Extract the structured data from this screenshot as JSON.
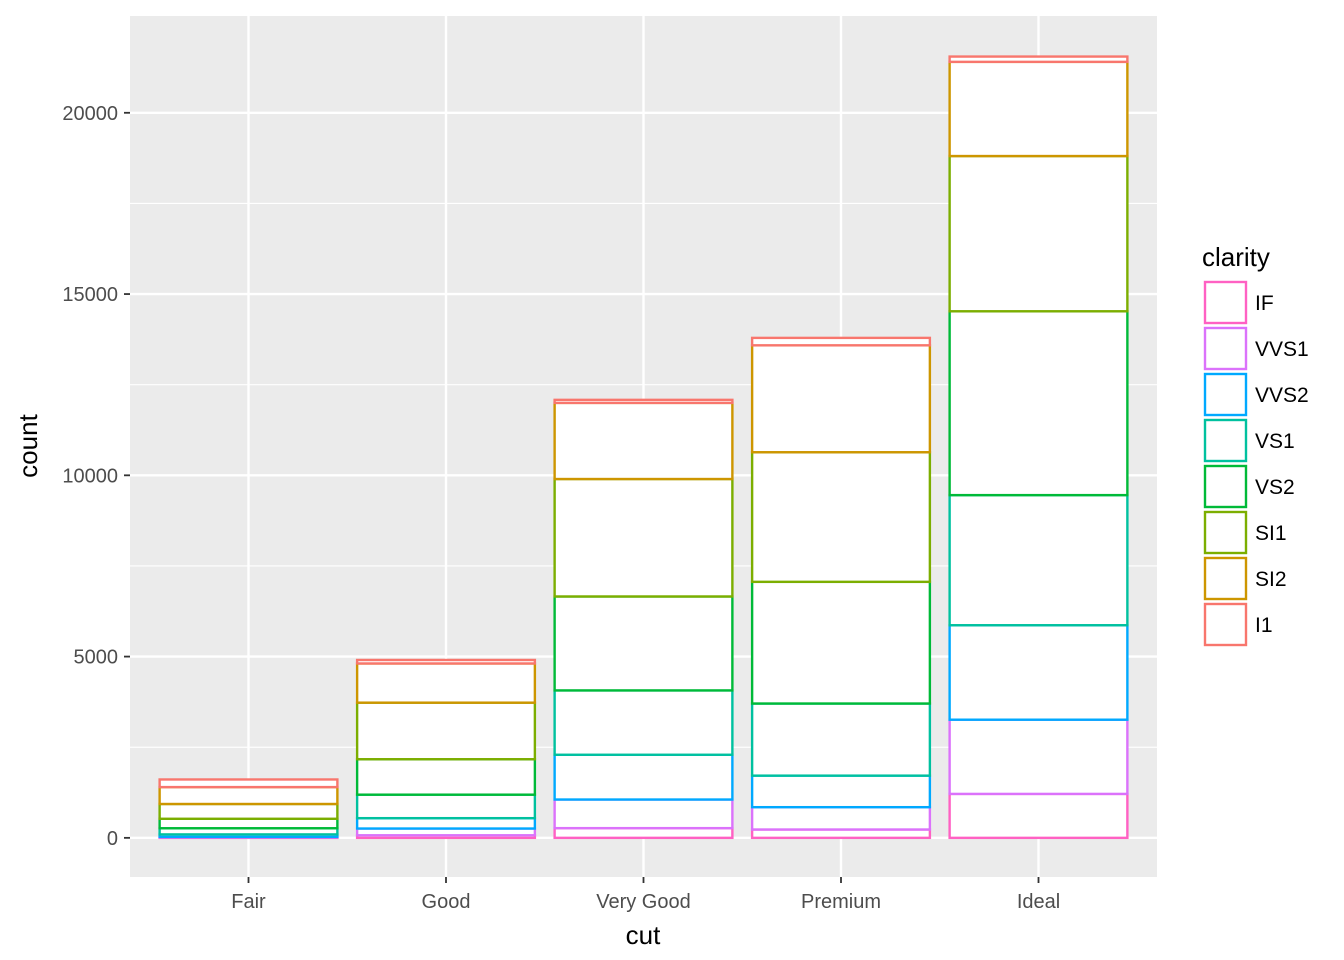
{
  "chart_data": {
    "type": "bar",
    "stacked": true,
    "title": "",
    "xlabel": "cut",
    "ylabel": "count",
    "categories": [
      "Fair",
      "Good",
      "Very Good",
      "Premium",
      "Ideal"
    ],
    "ylim": [
      -1080,
      22670
    ],
    "yticks": [
      0,
      5000,
      10000,
      15000,
      20000
    ],
    "ytick_labels": [
      "0",
      "5000",
      "10000",
      "15000",
      "20000"
    ],
    "grid": true,
    "fill": "#FFFFFF",
    "legend": {
      "title": "clarity",
      "position": "right"
    },
    "stack_order_bottom_to_top": [
      "IF",
      "VVS1",
      "VVS2",
      "VS1",
      "VS2",
      "SI1",
      "SI2",
      "I1"
    ],
    "series": [
      {
        "name": "IF",
        "color": "#FF61C3",
        "values": [
          9,
          71,
          268,
          230,
          1212
        ]
      },
      {
        "name": "VVS1",
        "color": "#DB72FB",
        "values": [
          17,
          186,
          789,
          616,
          2047
        ]
      },
      {
        "name": "VVS2",
        "color": "#00A9FF",
        "values": [
          69,
          286,
          1235,
          870,
          2606
        ]
      },
      {
        "name": "VS1",
        "color": "#00C19F",
        "values": [
          170,
          648,
          1775,
          1989,
          3589
        ]
      },
      {
        "name": "VS2",
        "color": "#00BA38",
        "values": [
          261,
          978,
          2591,
          3357,
          5071
        ]
      },
      {
        "name": "SI1",
        "color": "#7CAE00",
        "values": [
          408,
          1560,
          3240,
          3575,
          4282
        ]
      },
      {
        "name": "SI2",
        "color": "#CD9600",
        "values": [
          466,
          1081,
          2100,
          2949,
          2598
        ]
      },
      {
        "name": "I1",
        "color": "#F8766D",
        "values": [
          210,
          96,
          84,
          205,
          146
        ]
      }
    ]
  }
}
